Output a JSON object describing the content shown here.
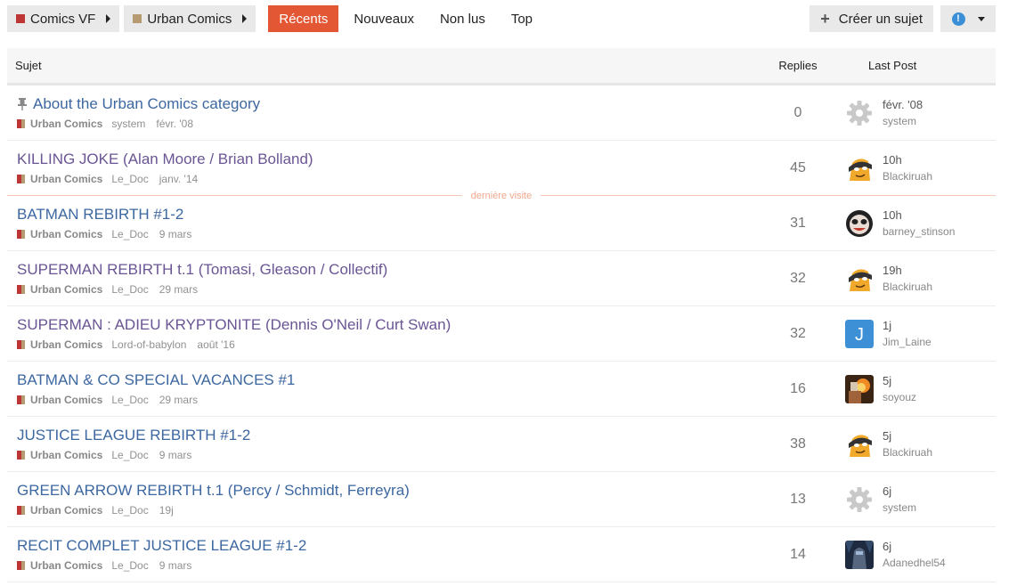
{
  "breadcrumbs": [
    {
      "label": "Comics VF",
      "color": "#bd3535"
    },
    {
      "label": "Urban Comics",
      "color": "#b59a72"
    }
  ],
  "nav": [
    {
      "label": "Récents",
      "active": true
    },
    {
      "label": "Nouveaux",
      "active": false
    },
    {
      "label": "Non lus",
      "active": false
    },
    {
      "label": "Top",
      "active": false
    }
  ],
  "create_topic_label": "Créer un sujet",
  "notification_icon": "info-icon",
  "columns": {
    "topic": "Sujet",
    "replies": "Replies",
    "last_post": "Last Post"
  },
  "last_visit_label": "dernière visite",
  "topics": [
    {
      "title": "About the Urban Comics category",
      "pinned": true,
      "visited": false,
      "category": "Urban Comics",
      "author": "system",
      "date": "févr. '08",
      "replies": "0",
      "last_time": "févr. '08",
      "last_user": "system",
      "avatar": "gear"
    },
    {
      "title": "KILLING JOKE (Alan Moore / Brian Bolland)",
      "pinned": false,
      "visited": true,
      "category": "Urban Comics",
      "author": "Le_Doc",
      "date": "janv. '14",
      "replies": "45",
      "last_time": "10h",
      "last_user": "Blackiruah",
      "avatar": "masked"
    },
    {
      "title": "BATMAN REBIRTH #1-2",
      "pinned": false,
      "visited": false,
      "category": "Urban Comics",
      "author": "Le_Doc",
      "date": "9 mars",
      "replies": "31",
      "last_time": "10h",
      "last_user": "barney_stinson",
      "avatar": "panda"
    },
    {
      "title": "SUPERMAN REBIRTH t.1 (Tomasi, Gleason / Collectif)",
      "pinned": false,
      "visited": true,
      "category": "Urban Comics",
      "author": "Le_Doc",
      "date": "29 mars",
      "replies": "32",
      "last_time": "19h",
      "last_user": "Blackiruah",
      "avatar": "masked"
    },
    {
      "title": "SUPERMAN : ADIEU KRYPTONITE (Dennis O'Neil / Curt Swan)",
      "pinned": false,
      "visited": true,
      "category": "Urban Comics",
      "author": "Lord-of-babylon",
      "date": "août '16",
      "replies": "32",
      "last_time": "1j",
      "last_user": "Jim_Laine",
      "avatar": "letter-j"
    },
    {
      "title": "BATMAN & CO SPECIAL VACANCES #1",
      "pinned": false,
      "visited": false,
      "category": "Urban Comics",
      "author": "Le_Doc",
      "date": "29 mars",
      "replies": "16",
      "last_time": "5j",
      "last_user": "soyouz",
      "avatar": "photo-fire"
    },
    {
      "title": "JUSTICE LEAGUE REBIRTH #1-2",
      "pinned": false,
      "visited": false,
      "category": "Urban Comics",
      "author": "Le_Doc",
      "date": "9 mars",
      "replies": "38",
      "last_time": "5j",
      "last_user": "Blackiruah",
      "avatar": "masked"
    },
    {
      "title": "GREEN ARROW REBIRTH t.1 (Percy / Schmidt, Ferreyra)",
      "pinned": false,
      "visited": false,
      "category": "Urban Comics",
      "author": "Le_Doc",
      "date": "19j",
      "replies": "13",
      "last_time": "6j",
      "last_user": "system",
      "avatar": "gear"
    },
    {
      "title": "RECIT COMPLET JUSTICE LEAGUE #1-2",
      "pinned": false,
      "visited": false,
      "category": "Urban Comics",
      "author": "Le_Doc",
      "date": "9 mars",
      "replies": "14",
      "last_time": "6j",
      "last_user": "Adanedhel54",
      "avatar": "photo-blue"
    }
  ]
}
